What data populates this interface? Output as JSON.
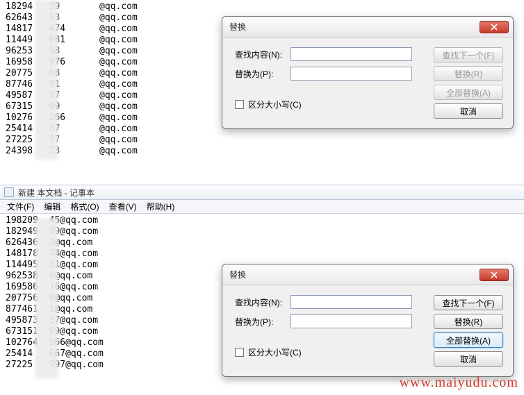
{
  "top_list": [
    {
      "c1": "18294   99",
      "c2": "@qq.com"
    },
    {
      "c1": "62643   63",
      "c2": "@qq.com"
    },
    {
      "c1": "14817   474",
      "c2": "@qq.com"
    },
    {
      "c1": "11449   681",
      "c2": "@qq.com"
    },
    {
      "c1": "96253   98",
      "c2": "@qq.com"
    },
    {
      "c1": "16958   976",
      "c2": "@qq.com"
    },
    {
      "c1": "20775   68",
      "c2": "@qq.com"
    },
    {
      "c1": "87746   01",
      "c2": "@qq.com"
    },
    {
      "c1": "49587   37",
      "c2": "@qq.com"
    },
    {
      "c1": "67315   09",
      "c2": "@qq.com"
    },
    {
      "c1": "10276   266",
      "c2": "@qq.com"
    },
    {
      "c1": "25414   67",
      "c2": "@qq.com"
    },
    {
      "c1": "27225   97",
      "c2": "@qq.com"
    },
    {
      "c1": "24398   73",
      "c2": "@qq.com"
    }
  ],
  "app": {
    "title": "新建   本文档 - 记事本"
  },
  "menu": {
    "file": "文件(F)",
    "edit": "编辑",
    "format": "格式(O)",
    "view": "查看(V)",
    "help": "帮助(H)"
  },
  "bottom_list": [
    "198209  45@qq.com",
    "182949  99@qq.com",
    "626436  3@qq.com",
    "148178  74@qq.com",
    "114495  81@qq.com",
    "962538  8@qq.com",
    "169586  76@qq.com",
    "207756  8@qq.com",
    "877461  1@qq.com",
    "495873  37@qq.com",
    "673151  09@qq.com",
    "102764  266@qq.com",
    "25414   667@qq.com",
    "27225   997@qq.com"
  ],
  "dialog1": {
    "title": "替换",
    "find_label": "查找内容(N):",
    "replace_label": "替换为(P):",
    "find_value": "",
    "replace_value": "",
    "case_label": "区分大小写(C)",
    "btn_findnext": "查找下一个(F)",
    "btn_replace": "替换(R)",
    "btn_replaceall": "全部替换(A)",
    "btn_cancel": "取消"
  },
  "dialog2": {
    "title": "替换",
    "find_label": "查找内容(N):",
    "replace_label": "替换为(P):",
    "find_value": "",
    "replace_value": "",
    "case_label": "区分大小写(C)",
    "btn_findnext": "查找下一个(F)",
    "btn_replace": "替换(R)",
    "btn_replaceall": "全部替换(A)",
    "btn_cancel": "取消"
  },
  "watermark": "www.maiyudu.com"
}
